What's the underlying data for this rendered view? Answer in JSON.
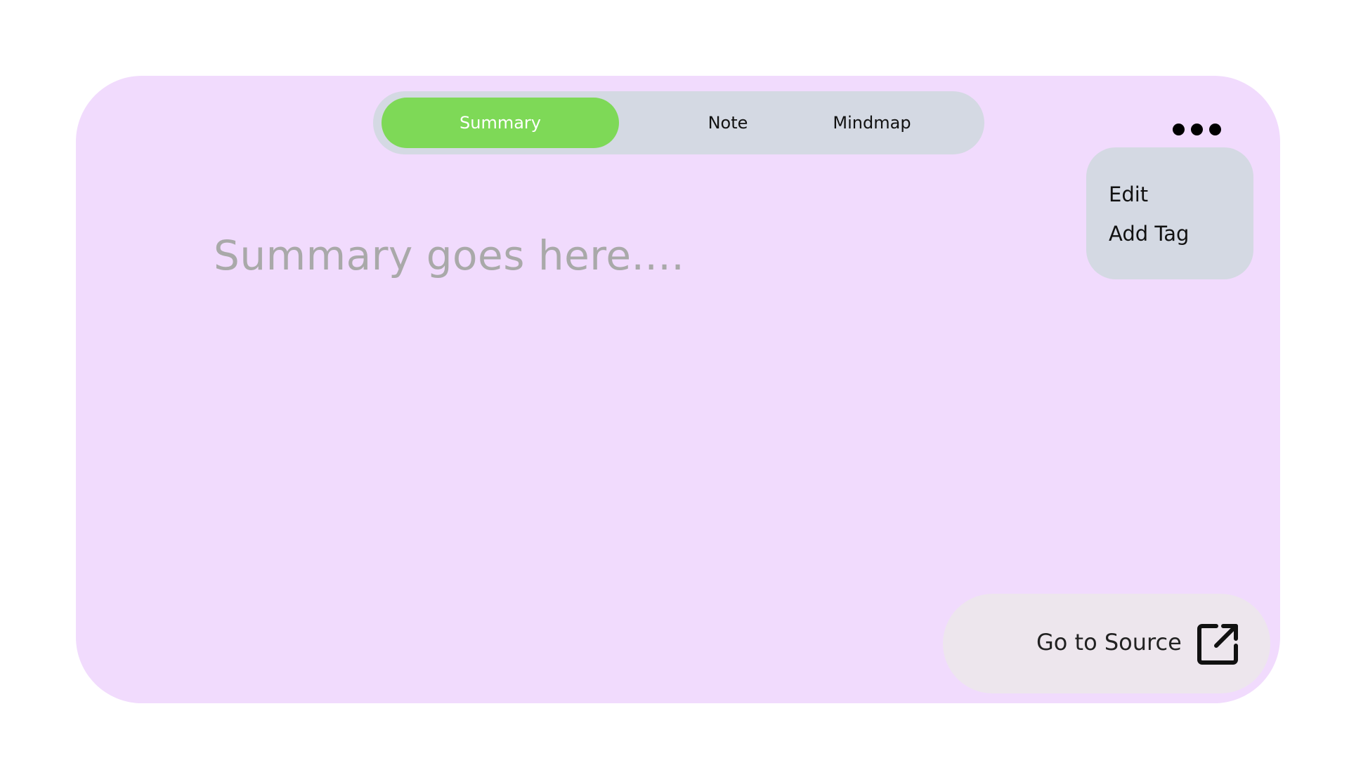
{
  "tabs": [
    {
      "label": "Summary",
      "active": true
    },
    {
      "label": "Note",
      "active": false
    },
    {
      "label": "Mindmap",
      "active": false
    }
  ],
  "menu": {
    "icon": "more-horizontal-icon",
    "items": [
      {
        "label": "Edit"
      },
      {
        "label": "Add Tag"
      }
    ]
  },
  "content": {
    "placeholder": "Summary goes here...."
  },
  "source_button": {
    "label": "Go to Source",
    "icon": "external-link-icon"
  },
  "colors": {
    "card_background": "#f1dbfd",
    "active_tab": "#7ed957",
    "tab_bar": "#d4d9e3",
    "dropdown": "#d4d9e3",
    "source_button": "#ede6ed"
  }
}
